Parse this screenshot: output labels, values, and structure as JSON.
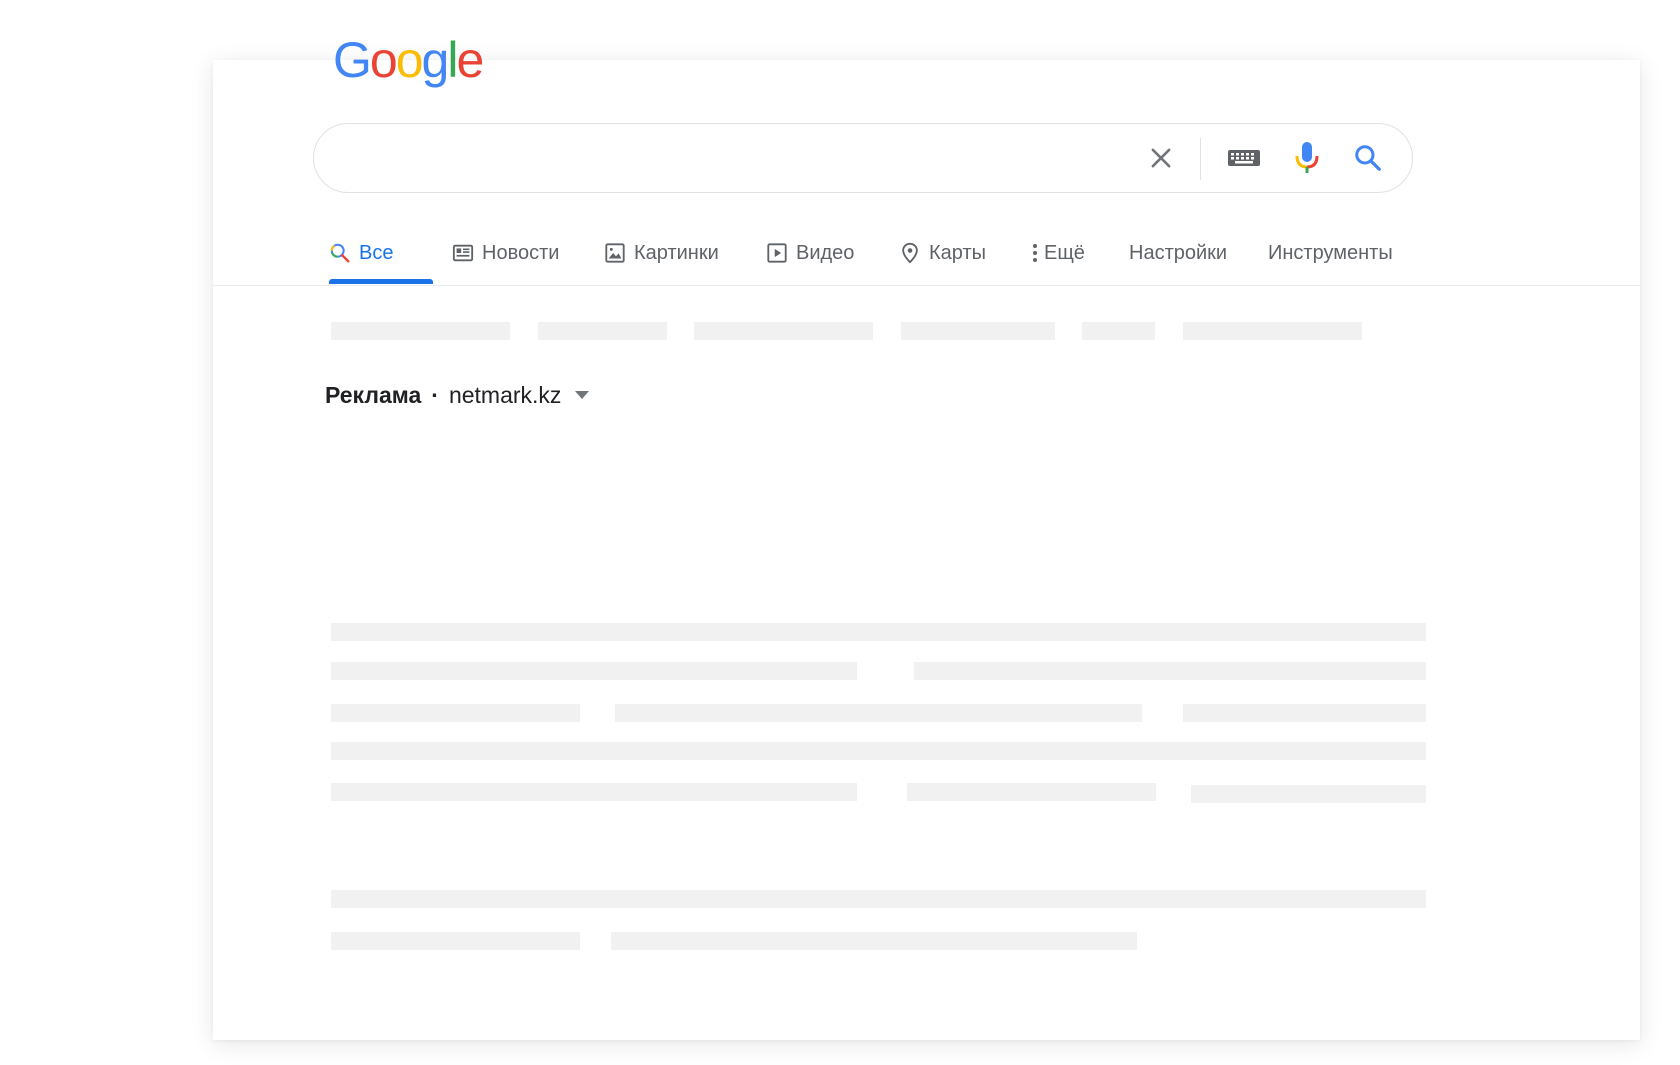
{
  "logo": {
    "letters": [
      "G",
      "o",
      "o",
      "g",
      "l",
      "e"
    ],
    "colors": [
      "#4285F4",
      "#EA4335",
      "#FBBC05",
      "#4285F4",
      "#34A853",
      "#EA4335"
    ]
  },
  "search": {
    "value": "",
    "placeholder": "",
    "icons": [
      "clear-icon",
      "keyboard-icon",
      "microphone-icon",
      "search-icon"
    ]
  },
  "tabs": [
    {
      "label": "Все",
      "icon": "search-icon",
      "active": true
    },
    {
      "label": "Новости",
      "icon": "news-icon",
      "active": false
    },
    {
      "label": "Картинки",
      "icon": "image-icon",
      "active": false
    },
    {
      "label": "Видео",
      "icon": "video-icon",
      "active": false
    },
    {
      "label": "Карты",
      "icon": "map-pin-icon",
      "active": false
    },
    {
      "label": "Ещё",
      "icon": "more-vert-icon",
      "active": false
    },
    {
      "label": "Настройки",
      "active": false
    },
    {
      "label": "Инструменты",
      "active": false
    }
  ],
  "ad": {
    "label": "Реклама",
    "separator": "·",
    "domain": "netmark.kz"
  },
  "colors": {
    "accent": "#1a73e8",
    "text": "#202124",
    "secondary_text": "#5f6368",
    "skeleton": "#f1f1f1",
    "border": "#dfe1e5"
  }
}
